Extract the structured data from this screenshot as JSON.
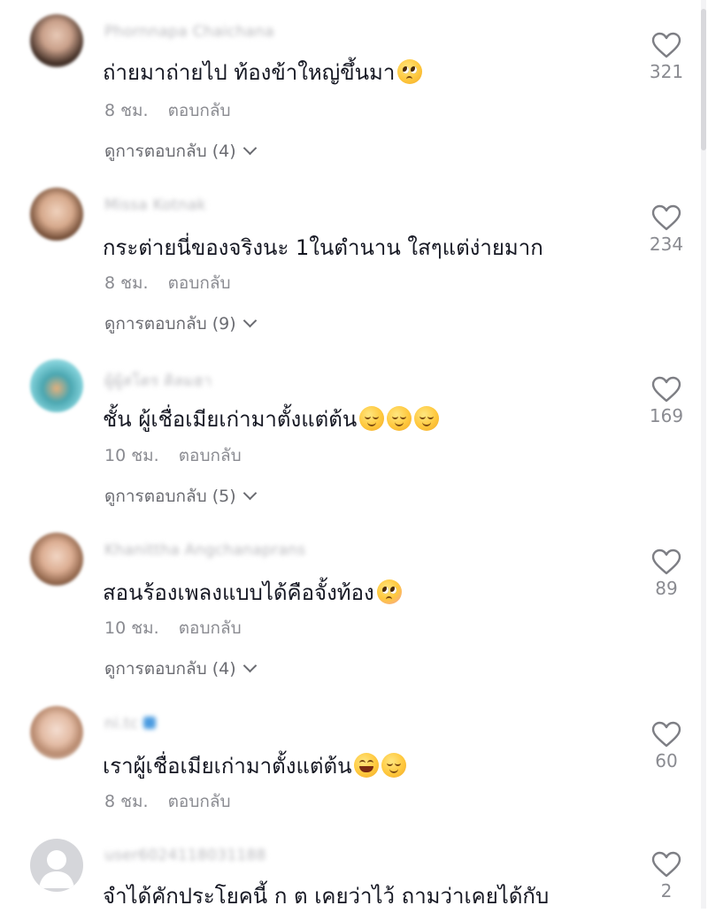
{
  "comments": [
    {
      "username": "Phornnapa Chaichana",
      "text": "ถ่ายมาถ่ายไป ท้องข้าใหญ่ขึ้นมา",
      "emojis": [
        "pleading-face-emoji"
      ],
      "time": "8 ชม.",
      "reply_label": "ตอบกลับ",
      "view_replies": "ดูการตอบกลับ (4)",
      "likes": "321"
    },
    {
      "username": "Missa Kotnak",
      "text": "กระต่ายนี่ของจริงนะ 1ในตำนาน ใสๆแต่ง่ายมาก",
      "emojis": [],
      "time": "8 ชม.",
      "reply_label": "ตอบกลับ",
      "view_replies": "ดูการตอบกลับ (9)",
      "likes": "234"
    },
    {
      "username": "ผู้ผู้สโตร คิลมฮา",
      "text": "ชั้น ผู้เชื่อเมียเก่ามาตั้งแต่ต้น",
      "emojis": [
        "relieved-face-emoji",
        "relieved-face-emoji",
        "relieved-face-emoji"
      ],
      "time": "10 ชม.",
      "reply_label": "ตอบกลับ",
      "view_replies": "ดูการตอบกลับ (5)",
      "likes": "169"
    },
    {
      "username": "Khanittha Angchanaprans",
      "text": "สอนร้องเพลงแบบได้คือจั้งท้อง",
      "emojis": [
        "flushed-face-emoji"
      ],
      "time": "10 ชม.",
      "reply_label": "ตอบกลับ",
      "view_replies": "ดูการตอบกลับ (4)",
      "likes": "89"
    },
    {
      "username": "ni.tc",
      "text": "เราผู้เชื่อเมียเก่ามาตั้งแต่ต้น",
      "emojis": [
        "tears-of-joy-emoji",
        "relieved-face-emoji"
      ],
      "time": "8 ชม.",
      "reply_label": "ตอบกลับ",
      "view_replies": "",
      "likes": "60"
    },
    {
      "username": "user6024118031188",
      "text": "จำได้คักประโยคนี้ ก ต เคยว่าไว้ ถามว่าเคยได้กับ",
      "emojis": [],
      "time": "",
      "reply_label": "",
      "view_replies": "",
      "likes": "2"
    }
  ],
  "colors": {
    "text": "#161823",
    "meta": "#8a8b91",
    "username": "#b8b8bc"
  },
  "icons": {
    "like": "heart-outline-icon",
    "expand": "chevron-down-icon"
  }
}
